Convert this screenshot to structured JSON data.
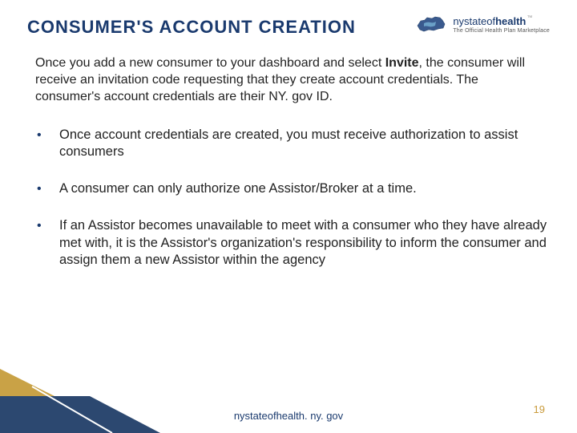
{
  "header": {
    "title": "CONSUMER'S ACCOUNT CREATION",
    "logo": {
      "main_html": "nystateof<b>health</b>",
      "sub": "The Official Health Plan Marketplace",
      "tm": "™"
    }
  },
  "intro": {
    "before": "Once you add a new consumer to your dashboard and select ",
    "bold": "Invite",
    "after": ", the consumer will receive an invitation code requesting that they create account credentials. The consumer's account credentials are their NY. gov ID."
  },
  "bullets": [
    "Once account credentials are created, you must receive authorization to assist consumers",
    "A consumer can only authorize one Assistor/Broker at a time.",
    "If an Assistor becomes unavailable to meet with a consumer who they have already met with, it is the Assistor's organization's responsibility to inform the consumer and assign them a new Assistor within the agency"
  ],
  "footer": {
    "url": "nystateofhealth. ny. gov",
    "page": "19"
  },
  "colors": {
    "brand_blue": "#1a3a6e",
    "accent_gold": "#c99a3a"
  }
}
